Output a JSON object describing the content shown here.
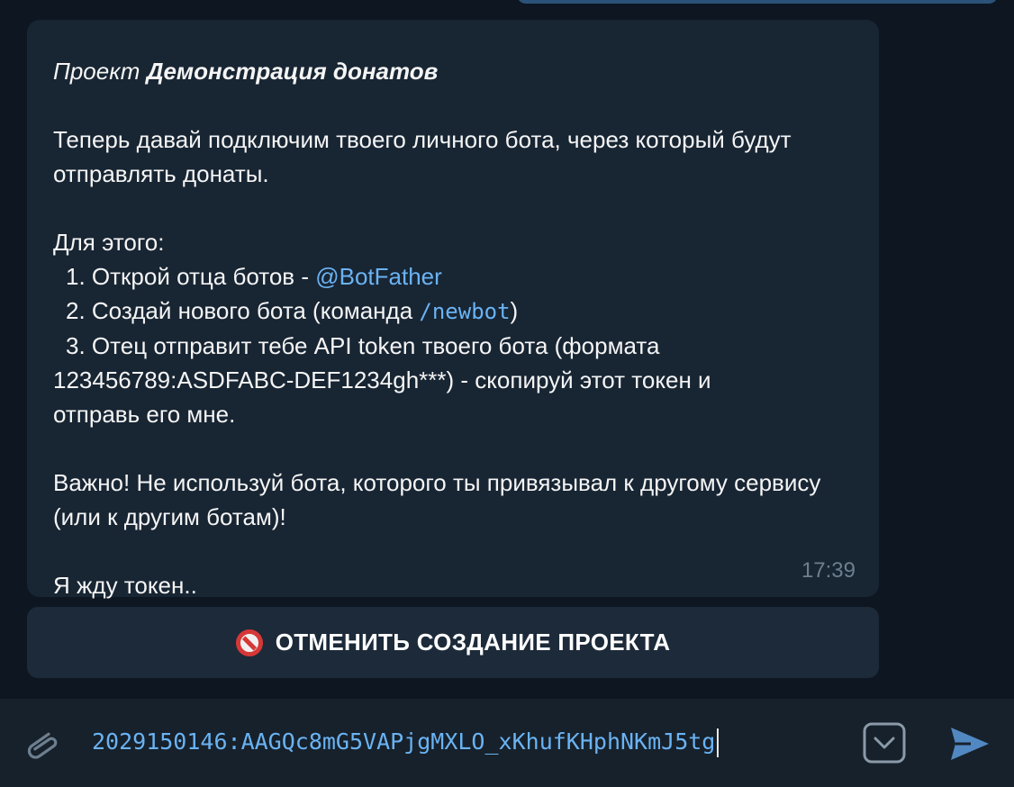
{
  "message": {
    "project_prefix": "Проект",
    "project_name": "Демонстрация донатов",
    "intro": "Теперь давай подключим твоего личного бота, через который будут отправлять донаты.",
    "steps_heading": "Для этого:",
    "step1_text": "1. Открой отца ботов - ",
    "step1_link": "@BotFather",
    "step2_text": "2. Создай нового бота (команда ",
    "step2_cmd": "/newbot",
    "step2_end": ")",
    "step3_line1": "3. Отец отправит тебе API token твоего бота (формата",
    "step3_line2": "123456789:ASDFABC-DEF1234gh***) - скопируй этот токен и",
    "step3_line3": "отправь его мне.",
    "warning": "Важно! Не используй бота, которого ты привязывал к другому сервису (или к другим ботам)!",
    "waiting": "Я жду токен..",
    "time": "17:39"
  },
  "inline_button": {
    "label": "ОТМЕНИТЬ СОЗДАНИЕ ПРОЕКТА",
    "icon": "no-entry-icon"
  },
  "composer": {
    "input_value": "2029150146:AAGQc8mG5VAPjgMXLO_xKhufKHphNKmJ5tg",
    "attach_icon": "paperclip-icon",
    "keyboard_icon": "bot-keyboard-icon",
    "send_icon": "send-icon"
  },
  "colors": {
    "background": "#0e1621",
    "bubble": "#182533",
    "link": "#6ab3f3",
    "composer": "#17212b"
  }
}
